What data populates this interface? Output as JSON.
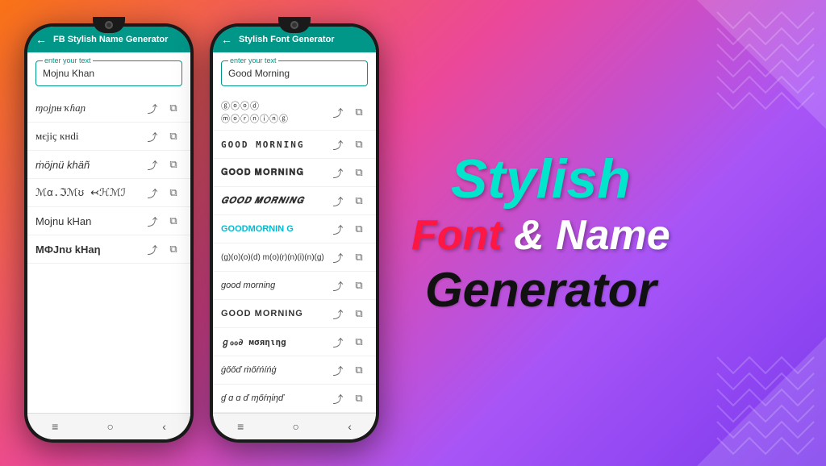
{
  "background": {
    "gradient": "135deg, #f97316, #ec4899, #a855f7, #7c3aed"
  },
  "phone1": {
    "appbar": {
      "title": "FB Stylish Name Generator",
      "back_label": "←"
    },
    "input": {
      "label": "enter your text",
      "value": "Mojnu Khan",
      "placeholder": "enter your text"
    },
    "fonts": [
      {
        "text": "ɱojɲʉ ҡɦaɲ",
        "style": "f1"
      },
      {
        "text": "мєjiç кнdi",
        "style": "f2"
      },
      {
        "text": "ṁöjnü khäñ",
        "style": "f3"
      },
      {
        "text": "ℳα.ℑℳʊ ↢ℋℳℐ",
        "style": "f4"
      },
      {
        "text": "Mojnu kHan",
        "style": "f5"
      },
      {
        "text": "MФJnʊ kHaη",
        "style": "f6"
      }
    ],
    "nav": [
      "≡",
      "○",
      "‹"
    ]
  },
  "phone2": {
    "appbar": {
      "title": "Stylish Font Generator",
      "back_label": "←"
    },
    "input": {
      "label": "enter your text",
      "value": "Good Morning",
      "placeholder": "enter your text"
    },
    "fonts": [
      {
        "text": "ⓖⓞⓞⓓ ⓜⓞⓡⓝⓘⓝⓖ",
        "style": "p2-f1"
      },
      {
        "text": "GOOD MORNING",
        "style": "p2-f2"
      },
      {
        "text": "𝐆𝐎𝐎𝐃 𝐌𝐎𝐑𝐍𝐈𝐍𝐆",
        "style": "p2-f3"
      },
      {
        "text": "𝑮𝑶𝑶𝑫 𝑴𝑶𝑹𝑵𝑰𝑵𝑮",
        "style": "p2-f4"
      },
      {
        "text": "GOODMORNIN G",
        "style": "p2-f5"
      },
      {
        "text": "(g)(o)(o)(d) m(o)(r)(n)(i)(n)(g)",
        "style": "p2-f6"
      },
      {
        "text": "good morning",
        "style": "p2-f7"
      },
      {
        "text": "GOOD MORNING",
        "style": "p2-f8"
      },
      {
        "text": "ℊℴℴ∂ мσяηιηg",
        "style": "p2-f9"
      },
      {
        "text": "ġőőď ṁőŕńíńġ",
        "style": "p2-f10"
      },
      {
        "text": "ɠ ɑ ɑ ď ɱőŕηίηď",
        "style": "p2-f11"
      }
    ],
    "nav": [
      "≡",
      "○",
      "‹"
    ]
  },
  "branding": {
    "line1": "Stylish",
    "line2_font": "Font",
    "line2_rest": " & Name",
    "line3": "Generator"
  },
  "icons": {
    "share": "⤴",
    "copy": "⧉",
    "back": "←"
  }
}
